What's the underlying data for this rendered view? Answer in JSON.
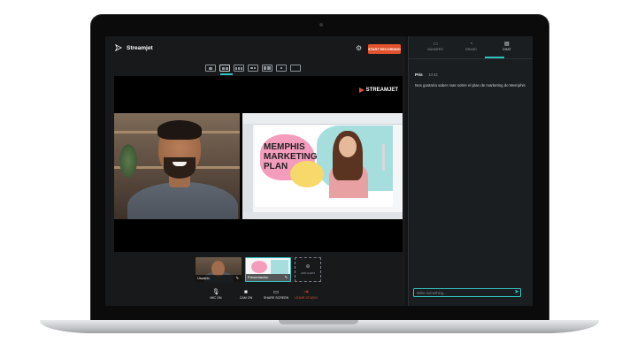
{
  "app": {
    "name": "Streamjet"
  },
  "header": {
    "record_label": "START RECORDING"
  },
  "stage": {
    "brand": "STREAMJET"
  },
  "slide": {
    "title": "MEMPHIS MARKETING PLAN"
  },
  "scenes": [
    {
      "label": "Usuario"
    },
    {
      "label": "Presentación"
    }
  ],
  "add_guest": {
    "label": "ADD GUEST"
  },
  "controls": {
    "mic": "MIC ON",
    "cam": "CAM ON",
    "share": "SHARE SCREEN",
    "leave": "LEAVE STUDIO"
  },
  "panel": {
    "tabs": [
      "BANNERS",
      "BRAND",
      "CHAT"
    ],
    "active_tab": "CHAT"
  },
  "chat": {
    "messages": [
      {
        "author": "Pris",
        "time": "10:43",
        "text": "Nos gustaría saber mas sobre el plan de marketing de Memphis"
      }
    ],
    "input_placeholder": "Write something..."
  },
  "colors": {
    "accent": "#2fc4c0",
    "record": "#e2532d",
    "background": "#17191b"
  },
  "icons": [
    "streamjet-logo-icon",
    "gear-icon",
    "microphone-icon",
    "camera-icon",
    "monitor-icon",
    "exit-icon",
    "add-user-icon",
    "send-icon",
    "banner-icon",
    "brand-icon",
    "chat-icon"
  ]
}
